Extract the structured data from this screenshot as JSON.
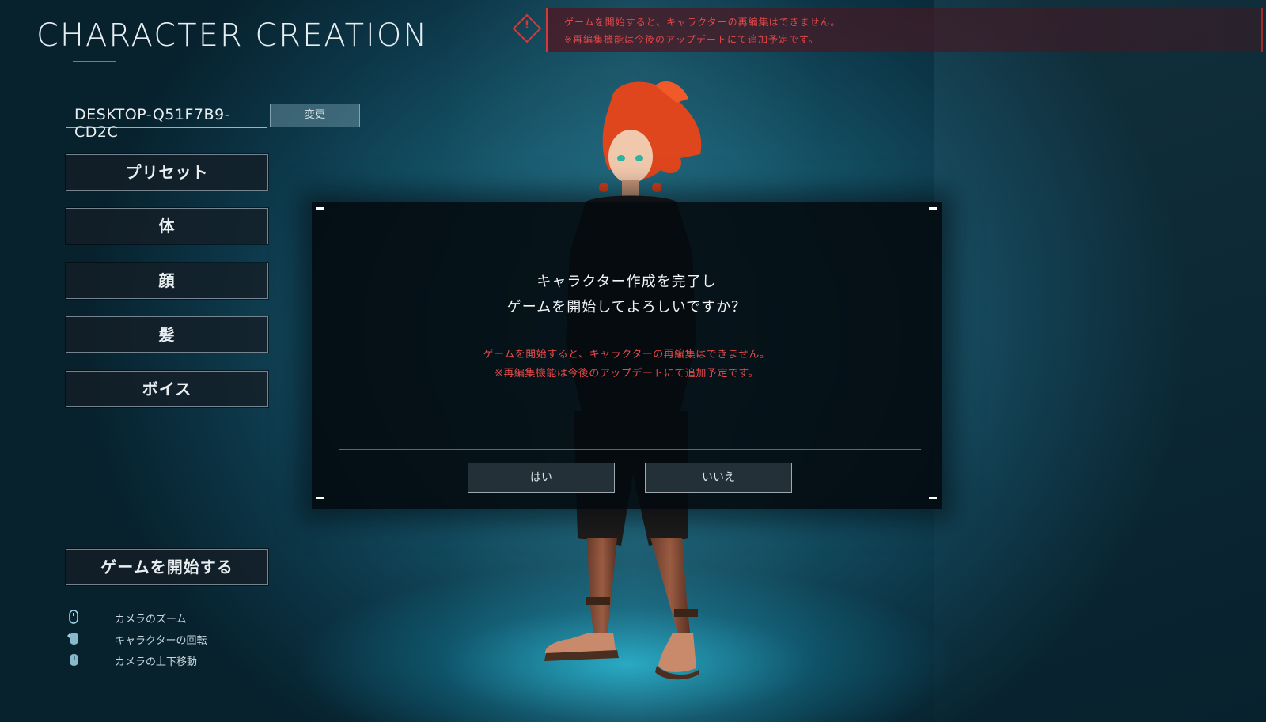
{
  "header": {
    "title": "CHARACTER CREATION",
    "warning_line1": "ゲームを開始すると、キャラクターの再編集はできません。",
    "warning_line2": "※再編集機能は今後のアップデートにて追加予定です。",
    "warning_icon": "exclamation-diamond-icon"
  },
  "player": {
    "name": "DESKTOP-Q51F7B9-CD2C",
    "change_label": "変更"
  },
  "menu": {
    "items": [
      {
        "label": "プリセット"
      },
      {
        "label": "体"
      },
      {
        "label": "顔"
      },
      {
        "label": "髪"
      },
      {
        "label": "ボイス"
      }
    ],
    "start_label": "ゲームを開始する"
  },
  "controls": [
    {
      "icon": "mouse-wheel-icon",
      "label": "カメラのズーム"
    },
    {
      "icon": "mouse-drag-icon",
      "label": "キャラクターの回転"
    },
    {
      "icon": "mouse-updown-icon",
      "label": "カメラの上下移動"
    }
  ],
  "dialog": {
    "question_line1": "キャラクター作成を完了し",
    "question_line2": "ゲームを開始してよろしいですか？",
    "warning_line1": "ゲームを開始すると、キャラクターの再編集はできません。",
    "warning_line2": "※再編集機能は今後のアップデートにて追加予定です。",
    "yes_label": "はい",
    "no_label": "いいえ"
  },
  "colors": {
    "accent_red": "#e84a4a",
    "background_teal": "#16576c"
  }
}
